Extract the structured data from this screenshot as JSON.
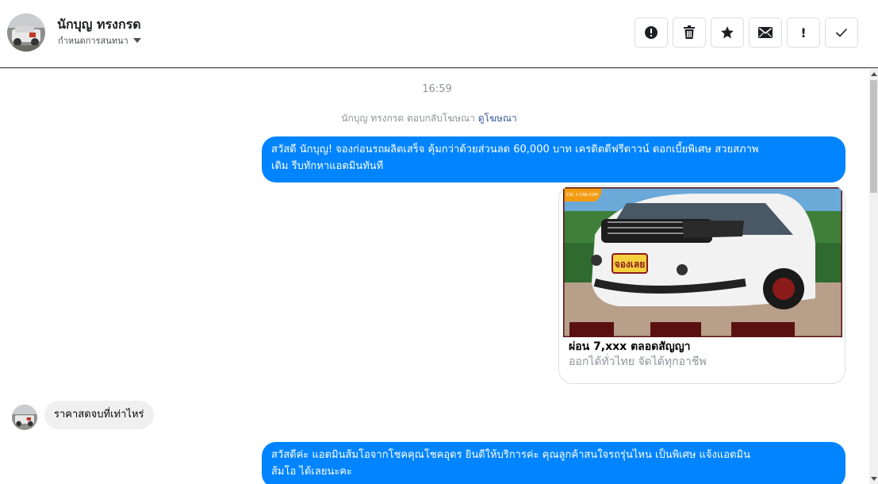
{
  "header": {
    "name": "นักบุญ ทรงกรด",
    "subtitle": "กำหนดการสนทนา",
    "actions": [
      {
        "name": "report-button",
        "icon": "exclamation-circle-icon"
      },
      {
        "name": "delete-button",
        "icon": "trash-icon"
      },
      {
        "name": "star-button",
        "icon": "star-icon"
      },
      {
        "name": "mark-unread-button",
        "icon": "envelope-icon"
      },
      {
        "name": "important-button",
        "icon": "exclamation-icon",
        "label": "!"
      },
      {
        "name": "done-button",
        "icon": "checkmark-icon"
      }
    ]
  },
  "thread": {
    "timestamp": "16:59",
    "reply_note": "นักบุญ ทรงกรด ตอบกลับโฆษณา",
    "reply_link": "ดูโฆษณา",
    "messages": [
      {
        "from": "page",
        "text_line1": "สวัสดี นักบุญ! จองก่อนรถผลิตเสร็จ คุ้มกว่าด้วยส่วนลด 60,000 บาท เครดิตดีฟรีดาวน์ ดอกเบี้ยพิเศษ สวยสภาพ",
        "text_line2": "เดิม รีบทักหาแอดมินทันที"
      },
      {
        "from": "page",
        "card": {
          "title": "ผ่อน 7,xxx ตลอดสัญญา",
          "subtitle": "ออกได้ทั่วไทย จัดได้ทุกอาชีพ",
          "image_logo": "CKC 2 CAR.COM",
          "image_badge": "จองเลย"
        }
      },
      {
        "from": "user",
        "text": "ราคาสดจบที่เท่าไหร่"
      },
      {
        "from": "page",
        "text_line1": "สวัสดีค่ะ แอดมินส้มโอจากโชคคุณโชคอุดร ยินดีให้บริการค่ะ  คุณลูกค้าสนใจรถรุ่นไหน เป็นพิเศษ แจ้งแอดมิน",
        "text_line2": "ส้มโอ ได้เลยนะคะ"
      }
    ]
  },
  "colors": {
    "outgoing_bubble": "#0084ff",
    "incoming_bubble": "#f1f0f0",
    "link": "#385898",
    "muted_text": "#90949c"
  }
}
